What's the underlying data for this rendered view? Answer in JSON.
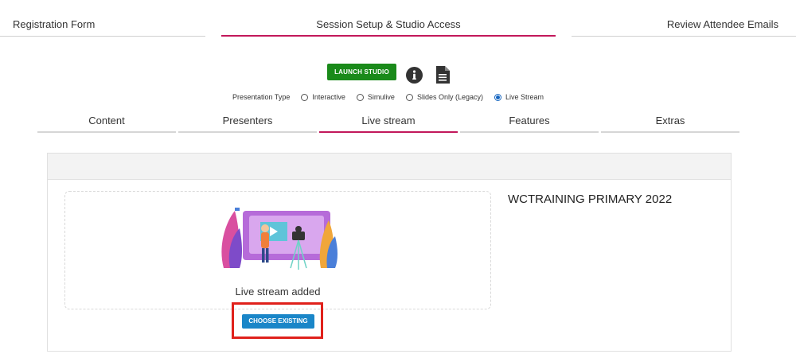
{
  "steps": [
    {
      "label": "Registration Form",
      "active": false
    },
    {
      "label": "Session Setup & Studio Access",
      "active": true
    },
    {
      "label": "Review Attendee Emails",
      "active": false
    }
  ],
  "toolbar": {
    "launch_label": "LAUNCH STUDIO",
    "info_icon": "info-icon",
    "doc_icon": "document-icon"
  },
  "presentation_type": {
    "label": "Presentation Type",
    "options": [
      "Interactive",
      "Simulive",
      "Slides Only (Legacy)",
      "Live Stream"
    ],
    "selected": "Live Stream"
  },
  "subtabs": [
    {
      "label": "Content",
      "active": false
    },
    {
      "label": "Presenters",
      "active": false
    },
    {
      "label": "Live stream",
      "active": true
    },
    {
      "label": "Features",
      "active": false
    },
    {
      "label": "Extras",
      "active": false
    }
  ],
  "live_stream": {
    "status": "Live stream added",
    "choose_label": "CHOOSE EXISTING",
    "name": "WCTRAINING PRIMARY 2022"
  },
  "colors": {
    "accent": "#c2185b",
    "launch_green": "#1a8a1a",
    "choose_blue": "#1a86c8",
    "highlight_red": "#e0211b"
  }
}
